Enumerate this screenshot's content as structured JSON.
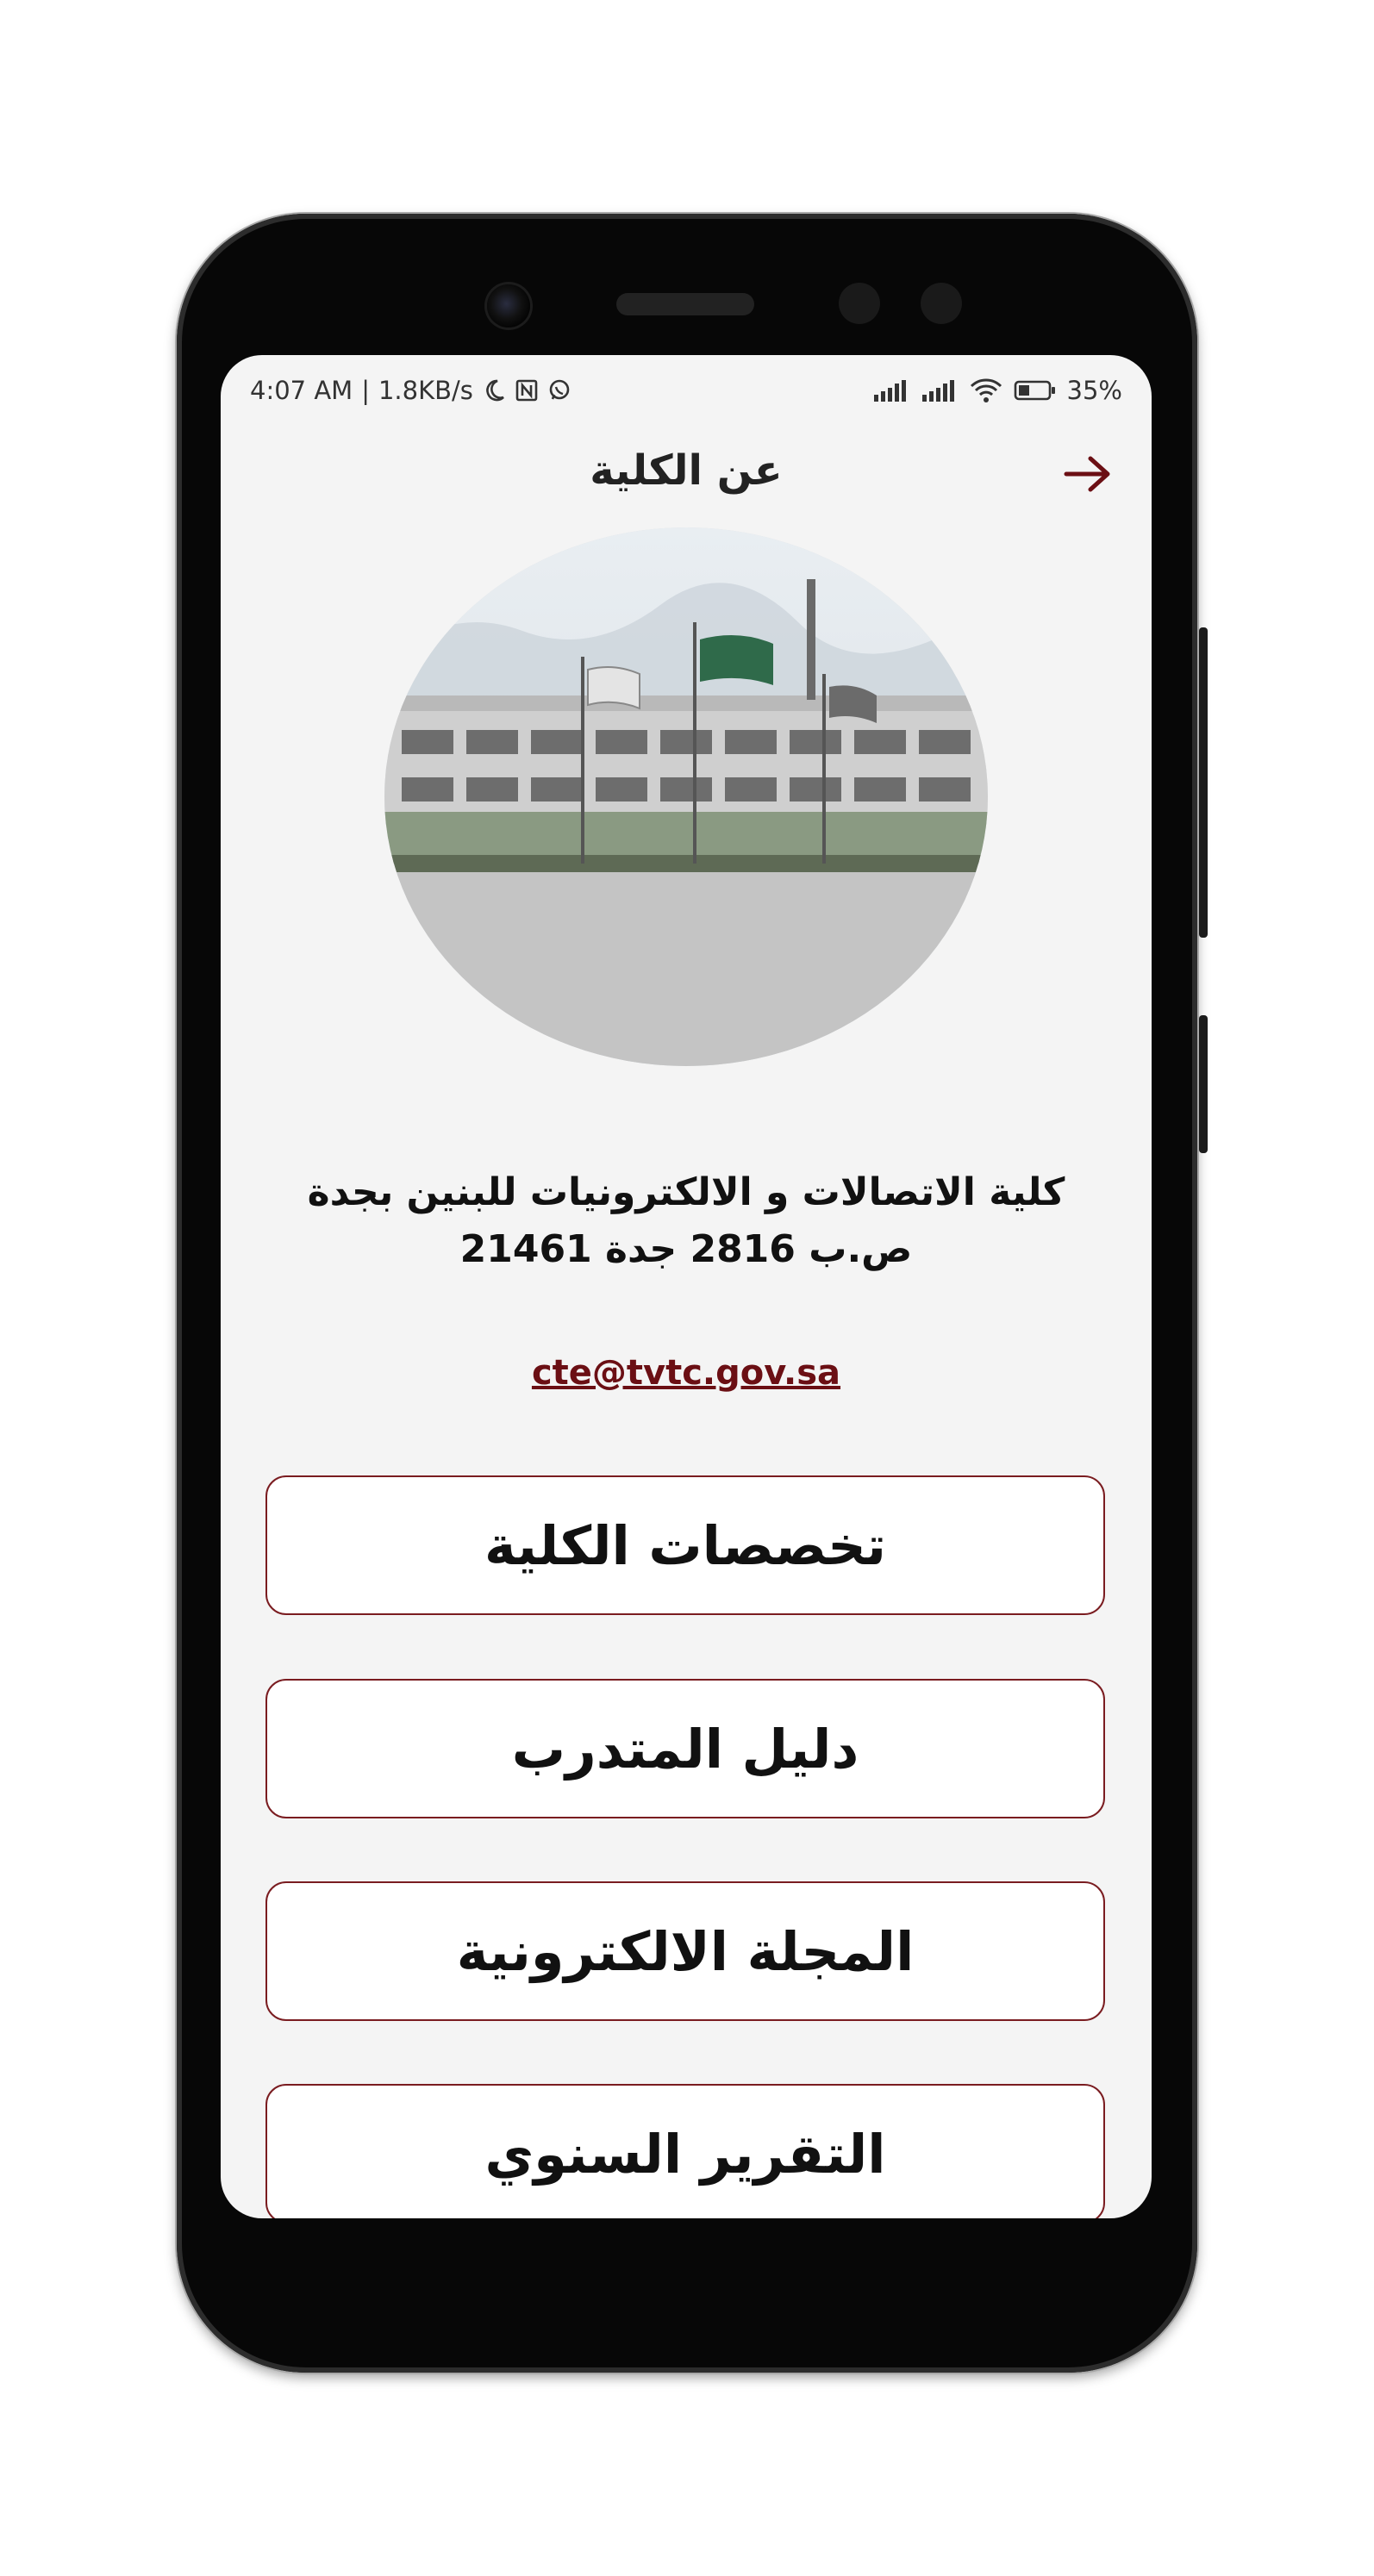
{
  "status_bar": {
    "time": "4:07 AM",
    "speed": "1.8KB/s",
    "battery": "35%",
    "icons": [
      "moon-icon",
      "nfc-icon",
      "whatsapp-icon",
      "signal-icon",
      "signal-icon",
      "wifi-icon",
      "battery-icon"
    ]
  },
  "header": {
    "title": "عن الكلية",
    "back_icon": "arrow-right-icon"
  },
  "college": {
    "name": "كلية الاتصالات و الالكترونيات للبنين بجدة",
    "po_box": "ص.ب 2816 جدة 21461",
    "email": "cte@tvtc.gov.sa"
  },
  "menu": [
    {
      "label": "تخصصات الكلية"
    },
    {
      "label": "دليل المتدرب"
    },
    {
      "label": "المجلة الالكترونية"
    },
    {
      "label": "التقرير السنوي"
    }
  ],
  "colors": {
    "accent": "#6b0f14",
    "screen_bg": "#f4f4f4",
    "button_border": "#7a1c20"
  }
}
